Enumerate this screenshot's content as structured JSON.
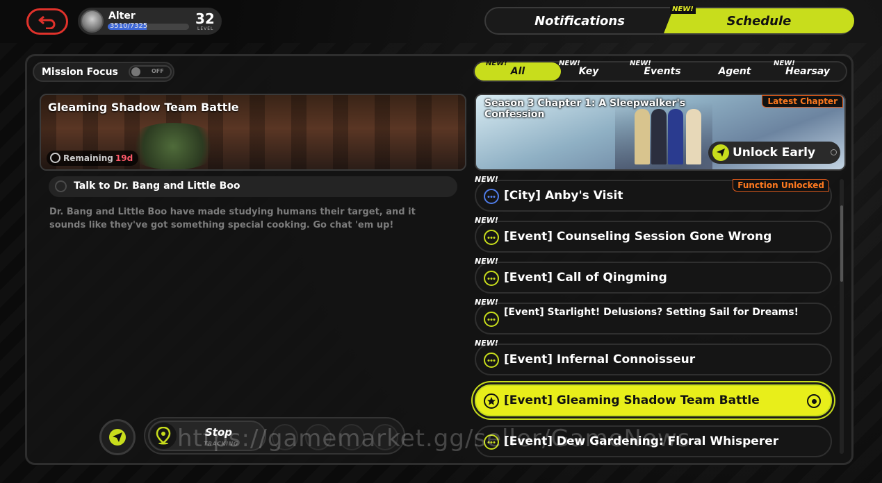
{
  "header": {
    "player_name": "Alter",
    "xp_text": "3510/7325",
    "xp_fraction": 0.479,
    "level": "32",
    "level_label": "LEVEL"
  },
  "top_tabs": {
    "notifications": "Notifications",
    "schedule": "Schedule",
    "schedule_new": "NEW!"
  },
  "mission_focus": {
    "label": "Mission Focus",
    "toggle_state": "OFF"
  },
  "filter_tabs": [
    {
      "label": "All",
      "new": "NEW!",
      "active": true
    },
    {
      "label": "Key",
      "new": "NEW!"
    },
    {
      "label": "Events",
      "new": "NEW!"
    },
    {
      "label": "Agent",
      "new": ""
    },
    {
      "label": "Hearsay",
      "new": "NEW!"
    }
  ],
  "mission": {
    "title": "Gleaming Shadow Team Battle",
    "remaining_label": "Remaining",
    "remaining_value": "19d",
    "task": "Talk to Dr. Bang and Little Boo",
    "description": "Dr. Bang and Little Boo have made studying humans their target, and it sounds like they've got something special cooking. Go chat 'em up!"
  },
  "tracking": {
    "stop_label": "Stop",
    "stop_sub": "TRACKING"
  },
  "chapter": {
    "title": "Season 3 Chapter 1: A Sleepwalker's Confession",
    "badge": "Latest Chapter",
    "unlock_label": "Unlock Early"
  },
  "schedule_list": [
    {
      "new": "NEW!",
      "label": "[City] Anby's Visit",
      "badge": "Function Unlocked",
      "kind": "city"
    },
    {
      "new": "NEW!",
      "label": "[Event] Counseling Session Gone Wrong",
      "kind": "event"
    },
    {
      "new": "NEW!",
      "label": "[Event] Call of Qingming",
      "kind": "event"
    },
    {
      "new": "NEW!",
      "label": "[Event] Starlight! Delusions? Setting Sail for Dreams!",
      "kind": "event"
    },
    {
      "new": "NEW!",
      "label": "[Event] Infernal Connoisseur",
      "kind": "event"
    },
    {
      "new": "",
      "label": "[Event] Gleaming Shadow Team Battle",
      "kind": "event",
      "active": true
    },
    {
      "new": "",
      "label": "[Event] Dew Gardening: Floral Whisperer",
      "kind": "event"
    }
  ],
  "watermark": "https://gamemarket.gg/seller/GameNews",
  "colors": {
    "accent": "#c8dd1c",
    "badge_orange": "#ff7a1f",
    "remaining_red": "#ff5a6a",
    "back_red": "#e0322b"
  }
}
